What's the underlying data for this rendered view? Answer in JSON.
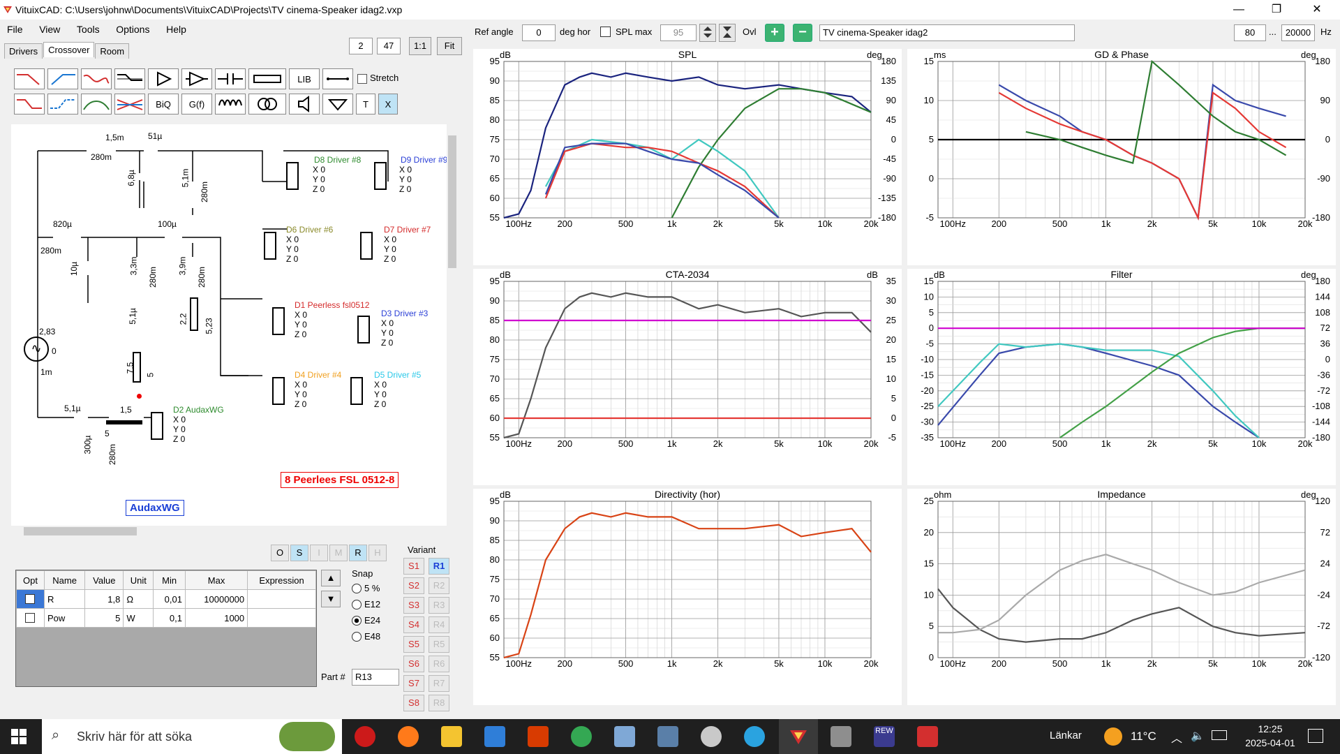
{
  "window": {
    "title": "VituixCAD: C:\\Users\\johnw\\Documents\\VituixCAD\\Projects\\TV cinema-Speaker idag2.vxp",
    "minimize": "—",
    "maximize": "❐",
    "close": "✕"
  },
  "menu": [
    "File",
    "View",
    "Tools",
    "Options",
    "Help"
  ],
  "tabs": [
    "Drivers",
    "Crossover",
    "Room"
  ],
  "crossover_toolbar": {
    "value1": "2",
    "value2": "47",
    "one_to_one": "1:1",
    "fit": "Fit",
    "lib": "LIB",
    "biq": "BiQ",
    "gf": "G(f)",
    "t": "T",
    "x": "X",
    "stretch": "Stretch"
  },
  "top_controls": {
    "ref_angle_label": "Ref angle",
    "ref_angle": "0",
    "deg_hor": "deg hor",
    "spl_max_label": "SPL max",
    "spl_max": "95",
    "ovl": "Ovl",
    "project_name": "TV cinema-Speaker idag2",
    "freq_min": "80",
    "freq_sep": "...",
    "freq_max": "20000",
    "hz": "Hz"
  },
  "schematic": {
    "components": {
      "l1": "1,5m",
      "l1r": "280m",
      "c1": "51µ",
      "c2": "6,8µ",
      "l2": "5,1m",
      "l2r": "280m",
      "l3": "820µ",
      "l3r": "280m",
      "c3": "10µ",
      "c4": "100µ",
      "l4": "3,3m",
      "l4r": "280m",
      "l5": "3,9m",
      "l5r": "280m",
      "c5": "5,1µ",
      "r1": "2,2",
      "r1b": "5,23",
      "r2": "7,5",
      "r2b": "5",
      "src_v": "2,83",
      "src_z": "0",
      "src_r": "1m",
      "c6": "5,1µ",
      "r3": "1,5",
      "r3b": "5",
      "l6": "300µ",
      "l6r": "280m"
    },
    "drivers": [
      {
        "name": "D8 Driver #8",
        "color": "#2e8b2e"
      },
      {
        "name": "D9 Driver #9",
        "color": "#2a3fd6"
      },
      {
        "name": "D6 Driver #6",
        "color": "#8a8a2a"
      },
      {
        "name": "D7 Driver #7",
        "color": "#d42a2a"
      },
      {
        "name": "D1 Peerless fsl0512",
        "color": "#d42a2a"
      },
      {
        "name": "D3 Driver #3",
        "color": "#2a3fd6"
      },
      {
        "name": "D4 Driver #4",
        "color": "#f0a020"
      },
      {
        "name": "D5 Driver #5",
        "color": "#2ac8e8"
      },
      {
        "name": "D2 AudaxWG",
        "color": "#2e8b2e"
      }
    ],
    "xyz": [
      "X 0",
      "Y 0",
      "Z 0"
    ],
    "label_red": "8 Peerlees FSL 0512-8",
    "label_blue": "AudaxWG"
  },
  "mode_buttons": [
    "O",
    "S",
    "I",
    "M",
    "R",
    "H"
  ],
  "parts_table": {
    "headers": [
      "Opt",
      "Name",
      "Value",
      "Unit",
      "Min",
      "Max",
      "Expression"
    ],
    "rows": [
      {
        "name": "R",
        "value": "1,8",
        "unit": "Ω",
        "min": "0,01",
        "max": "10000000",
        "expr": ""
      },
      {
        "name": "Pow",
        "value": "5",
        "unit": "W",
        "min": "0,1",
        "max": "1000",
        "expr": ""
      }
    ]
  },
  "snap": {
    "label": "Snap",
    "options": [
      "5 %",
      "E12",
      "E24",
      "E48"
    ],
    "selected": "E24"
  },
  "part_no": {
    "label": "Part #",
    "value": "R13"
  },
  "variant": {
    "label": "Variant",
    "s": [
      "S1",
      "S2",
      "S3",
      "S4",
      "S5",
      "S6",
      "S7",
      "S8"
    ],
    "r": [
      "R1",
      "R2",
      "R3",
      "R4",
      "R5",
      "R6",
      "R7",
      "R8"
    ]
  },
  "charts": {
    "freq_ticks": [
      "100Hz",
      "200",
      "500",
      "1k",
      "2k",
      "5k",
      "10k",
      "20k"
    ],
    "spl": {
      "title": "SPL",
      "yunit": "dB",
      "y2unit": "deg",
      "yticks": [
        "95",
        "90",
        "85",
        "80",
        "75",
        "70",
        "65",
        "60",
        "55"
      ],
      "y2ticks": [
        "180",
        "135",
        "90",
        "45",
        "0",
        "-45",
        "-90",
        "-135",
        "-180"
      ]
    },
    "gd": {
      "title": "GD & Phase",
      "yunit": "ms",
      "y2unit": "deg",
      "yticks": [
        "15",
        "10",
        "5",
        "0",
        "-5"
      ],
      "y2ticks": [
        "180",
        "90",
        "0",
        "-90",
        "-180"
      ]
    },
    "cta": {
      "title": "CTA-2034",
      "yunit": "dB",
      "y2unit": "dB",
      "yticks": [
        "95",
        "90",
        "85",
        "80",
        "75",
        "70",
        "65",
        "60",
        "55"
      ],
      "y2ticks": [
        "35",
        "30",
        "25",
        "20",
        "15",
        "10",
        "5",
        "0",
        "-5"
      ]
    },
    "filter": {
      "title": "Filter",
      "yunit": "dB",
      "y2unit": "deg",
      "yticks": [
        "15",
        "10",
        "5",
        "0",
        "-5",
        "-10",
        "-15",
        "-20",
        "-25",
        "-30",
        "-35"
      ],
      "y2ticks": [
        "180",
        "144",
        "108",
        "72",
        "36",
        "0",
        "-36",
        "-72",
        "-108",
        "-144",
        "-180"
      ]
    },
    "directivity": {
      "title": "Directivity (hor)",
      "yunit": "dB",
      "yticks": [
        "95",
        "90",
        "85",
        "80",
        "75",
        "70",
        "65",
        "60",
        "55"
      ]
    },
    "impedance": {
      "title": "Impedance",
      "yunit": "ohm",
      "y2unit": "deg",
      "yticks": [
        "25",
        "20",
        "15",
        "10",
        "5",
        "0"
      ],
      "y2ticks": [
        "120",
        "72",
        "24",
        "-24",
        "-72",
        "-120"
      ]
    }
  },
  "chart_data": [
    {
      "type": "line",
      "title": "SPL",
      "x_scale": "log",
      "xlim": [
        80,
        20000
      ],
      "ylim": [
        55,
        95
      ],
      "ylabel": "dB",
      "y2label": "deg",
      "y2lim": [
        -180,
        180
      ],
      "series": [
        {
          "color": "#1a237e",
          "x": [
            80,
            100,
            120,
            150,
            200,
            250,
            300,
            400,
            500,
            700,
            1000,
            1500,
            2000,
            3000,
            5000,
            7000,
            10000,
            15000,
            20000
          ],
          "y": [
            55,
            56,
            62,
            78,
            89,
            91,
            92,
            91,
            92,
            91,
            90,
            91,
            89,
            88,
            89,
            88,
            87,
            86,
            82
          ]
        },
        {
          "color": "#2e7d32",
          "x": [
            1000,
            1500,
            2000,
            3000,
            5000,
            7000,
            10000,
            20000
          ],
          "y": [
            55,
            68,
            75,
            83,
            88,
            88,
            87,
            82
          ]
        },
        {
          "color": "#40c8c0",
          "x": [
            150,
            200,
            300,
            500,
            700,
            1000,
            1500,
            2000,
            3000,
            5000
          ],
          "y": [
            63,
            72,
            75,
            74,
            73,
            70,
            75,
            72,
            67,
            55
          ]
        },
        {
          "color": "#e53935",
          "x": [
            150,
            200,
            300,
            500,
            700,
            1000,
            1500,
            2000,
            3000,
            5000
          ],
          "y": [
            60,
            72,
            74,
            73,
            73,
            72,
            69,
            67,
            63,
            55
          ]
        },
        {
          "color": "#3949ab",
          "x": [
            150,
            200,
            300,
            500,
            700,
            1000,
            1500,
            2000,
            3000,
            5000
          ],
          "y": [
            61,
            73,
            74,
            74,
            72,
            70,
            69,
            66,
            62,
            55
          ]
        }
      ]
    },
    {
      "type": "line",
      "title": "GD & Phase",
      "x_scale": "log",
      "xlim": [
        80,
        20000
      ],
      "ylim": [
        -5,
        15
      ],
      "ylabel": "ms",
      "y2label": "deg",
      "y2lim": [
        -180,
        180
      ],
      "series": [
        {
          "color": "#000000",
          "x": [
            80,
            20000
          ],
          "y": [
            5,
            5
          ]
        },
        {
          "color": "#3949ab",
          "x": [
            200,
            300,
            500,
            700,
            1000,
            1500,
            2000,
            3000,
            4000,
            5000,
            7000,
            10000,
            15000
          ],
          "y": [
            12,
            10,
            8,
            6,
            5,
            3,
            2,
            0,
            -5,
            12,
            10,
            9,
            8
          ]
        },
        {
          "color": "#e53935",
          "x": [
            200,
            300,
            500,
            700,
            1000,
            1500,
            2000,
            3000,
            4000,
            5000,
            7000,
            10000,
            15000
          ],
          "y": [
            11,
            9,
            7,
            6,
            5,
            3,
            2,
            0,
            -5,
            11,
            9,
            6,
            4
          ]
        },
        {
          "color": "#2e7d32",
          "x": [
            300,
            500,
            700,
            1000,
            1500,
            2000,
            3000,
            5000,
            7000,
            10000,
            15000
          ],
          "y": [
            6,
            5,
            4,
            3,
            2,
            15,
            12,
            8,
            6,
            5,
            3
          ]
        }
      ]
    },
    {
      "type": "line",
      "title": "CTA-2034",
      "x_scale": "log",
      "xlim": [
        80,
        20000
      ],
      "ylim": [
        55,
        95
      ],
      "ylabel": "dB",
      "y2label": "dB",
      "y2lim": [
        -5,
        35
      ],
      "series": [
        {
          "color": "#555555",
          "x": [
            80,
            100,
            120,
            150,
            200,
            250,
            300,
            400,
            500,
            700,
            1000,
            1500,
            2000,
            3000,
            5000,
            7000,
            10000,
            15000,
            20000
          ],
          "y": [
            55,
            56,
            65,
            78,
            88,
            91,
            92,
            91,
            92,
            91,
            91,
            88,
            89,
            87,
            88,
            86,
            87,
            87,
            82
          ]
        },
        {
          "color": "#d000d0",
          "x": [
            80,
            20000
          ],
          "y": [
            85,
            85
          ]
        },
        {
          "color": "#e53935",
          "x": [
            80,
            20000
          ],
          "y": [
            60,
            60
          ]
        }
      ]
    },
    {
      "type": "line",
      "title": "Filter",
      "x_scale": "log",
      "xlim": [
        80,
        20000
      ],
      "ylim": [
        -35,
        15
      ],
      "ylabel": "dB",
      "y2label": "deg",
      "y2lim": [
        -180,
        180
      ],
      "series": [
        {
          "color": "#3949ab",
          "x": [
            80,
            150,
            200,
            300,
            500,
            700,
            1000,
            2000,
            3000,
            5000,
            7000,
            10000
          ],
          "y": [
            -31,
            -15,
            -8,
            -6,
            -5,
            -6,
            -8,
            -12,
            -15,
            -25,
            -30,
            -35
          ]
        },
        {
          "color": "#40c8c0",
          "x": [
            80,
            150,
            200,
            300,
            500,
            700,
            1000,
            2000,
            3000,
            5000,
            7000,
            10000
          ],
          "y": [
            -25,
            -11,
            -5,
            -6,
            -5,
            -6,
            -7,
            -7,
            -9,
            -20,
            -28,
            -35
          ]
        },
        {
          "color": "#43a047",
          "x": [
            500,
            700,
            1000,
            2000,
            3000,
            5000,
            7000,
            10000,
            20000
          ],
          "y": [
            -35,
            -30,
            -25,
            -14,
            -8,
            -3,
            -1,
            0,
            0
          ]
        },
        {
          "color": "#d000d0",
          "x": [
            80,
            20000
          ],
          "y": [
            0,
            0
          ]
        }
      ]
    },
    {
      "type": "line",
      "title": "Directivity (hor)",
      "x_scale": "log",
      "xlim": [
        80,
        20000
      ],
      "ylim": [
        55,
        95
      ],
      "ylabel": "dB",
      "series": [
        {
          "color": "#d84315",
          "x": [
            80,
            100,
            120,
            150,
            200,
            250,
            300,
            400,
            500,
            700,
            1000,
            1500,
            2000,
            3000,
            5000,
            7000,
            10000,
            15000,
            20000
          ],
          "y": [
            55,
            56,
            66,
            80,
            88,
            91,
            92,
            91,
            92,
            91,
            91,
            88,
            88,
            88,
            89,
            86,
            87,
            88,
            82
          ]
        }
      ]
    },
    {
      "type": "line",
      "title": "Impedance",
      "x_scale": "log",
      "xlim": [
        80,
        20000
      ],
      "ylim": [
        0,
        25
      ],
      "ylabel": "ohm",
      "y2label": "deg",
      "y2lim": [
        -120,
        120
      ],
      "series": [
        {
          "color": "#555555",
          "x": [
            80,
            100,
            150,
            200,
            300,
            500,
            700,
            1000,
            1500,
            2000,
            3000,
            5000,
            7000,
            10000,
            20000
          ],
          "y": [
            11,
            8,
            4.5,
            3,
            2.5,
            3,
            3,
            4,
            6,
            7,
            8,
            5,
            4,
            3.5,
            4
          ]
        },
        {
          "color": "#aaaaaa",
          "x": [
            80,
            100,
            150,
            200,
            300,
            500,
            700,
            1000,
            1500,
            2000,
            3000,
            5000,
            7000,
            10000,
            20000
          ],
          "y": [
            4,
            4,
            4.5,
            6,
            10,
            14,
            15.5,
            16.5,
            15,
            14,
            12,
            10,
            10.5,
            12,
            14
          ]
        }
      ]
    }
  ],
  "taskbar": {
    "search_placeholder": "Skriv här för att söka",
    "links": "Länkar",
    "temperature": "11°C",
    "time": "12:25",
    "date": "2025-04-01",
    "rew": "REW"
  }
}
